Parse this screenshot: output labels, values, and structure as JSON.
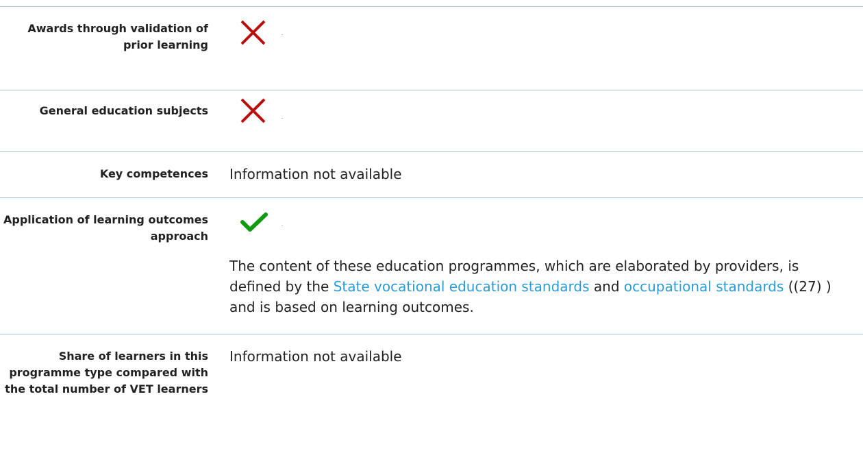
{
  "rows": [
    {
      "label": "Awards through validation of prior learning",
      "status": "no",
      "icon": "cross-icon"
    },
    {
      "label": "General education subjects",
      "status": "no",
      "icon": "cross-icon"
    },
    {
      "label": "Key competences",
      "value": "Information not available"
    },
    {
      "label": "Application of learning outcomes approach",
      "status": "yes",
      "icon": "check-icon",
      "description": {
        "part1": "The content of these education programmes, which are elaborated by providers, is defined by the ",
        "link1": "State vocational education standards",
        "part2": " and ",
        "link2": "occupational standards",
        "part3": " ((27) ) and is based on learning outcomes."
      }
    },
    {
      "label": "Share of learners in this programme type compared with the total number of VET learners",
      "value": "Information not available"
    }
  ],
  "colors": {
    "cross": "#b70d0d",
    "check": "#109a10",
    "link": "#2b9bd8",
    "divider": "#a9c4dc"
  }
}
